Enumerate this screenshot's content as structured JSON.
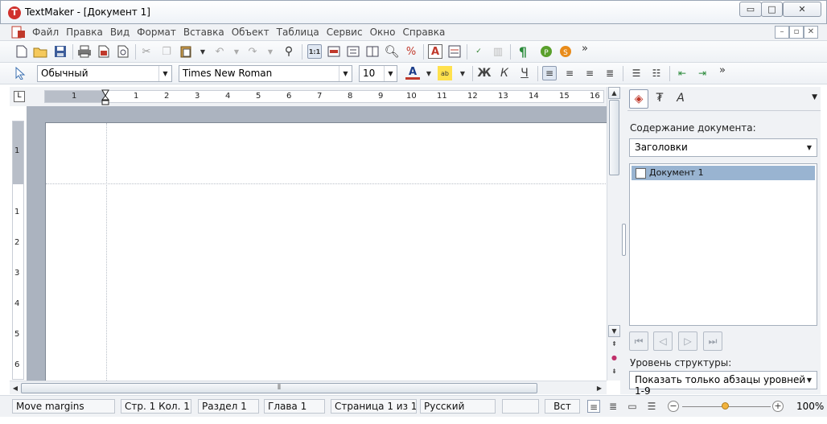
{
  "window": {
    "title": "TextMaker - [Документ 1]",
    "logo_letter": "T",
    "min_glyph": "▭",
    "max_glyph": "□",
    "close_glyph": "✕"
  },
  "menu": {
    "items": [
      "Файл",
      "Правка",
      "Вид",
      "Формат",
      "Вставка",
      "Объект",
      "Таблица",
      "Сервис",
      "Окно",
      "Справка"
    ]
  },
  "toolbar1": {
    "overflow": "»"
  },
  "toolbar2": {
    "style_value": "Обычный",
    "font_value": "Times New Roman",
    "size_value": "10",
    "bold_label": "Ж",
    "italic_label": "К",
    "underline_label": "Ч",
    "overflow": "»"
  },
  "ruler": {
    "corner": "L",
    "h_labels": [
      "1",
      "1",
      "2",
      "3",
      "4",
      "5",
      "6",
      "7",
      "8",
      "9",
      "10",
      "11",
      "12",
      "13",
      "14",
      "15",
      "16"
    ],
    "v_labels": [
      "1",
      "1",
      "2",
      "3",
      "4",
      "5",
      "6"
    ]
  },
  "sidebar": {
    "contents_label": "Содержание документа:",
    "contents_combo": "Заголовки",
    "tree_item": "Документ 1",
    "level_label": "Уровень структуры:",
    "level_combo": "Показать только абзацы уровней 1-9"
  },
  "statusbar": {
    "hint": "Move margins",
    "position": "Стр. 1 Кол. 1",
    "section": "Раздел 1",
    "chapter": "Глава 1",
    "page": "Страница 1 из 1",
    "language": "Русский",
    "insert_mode": "Вст",
    "zoom": "100%"
  }
}
